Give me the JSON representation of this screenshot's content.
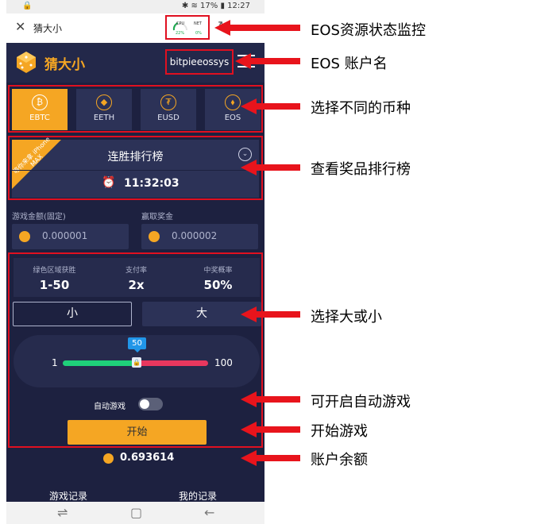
{
  "status_bar": {
    "battery": "17%",
    "time": "12:27"
  },
  "browser": {
    "title": "猜大小"
  },
  "resource_monitor": {
    "cpu_label": "CPU",
    "cpu_value": "22%",
    "net_label": "NET",
    "net_value": "0%"
  },
  "app": {
    "name": "猜大小",
    "account": "bitpieeossys"
  },
  "coins": [
    {
      "label": "EBTC",
      "icon": "bitcoin-icon",
      "active": true
    },
    {
      "label": "EETH",
      "icon": "ethereum-icon",
      "active": false
    },
    {
      "label": "EUSD",
      "icon": "tether-icon",
      "active": false
    },
    {
      "label": "EOS",
      "icon": "eos-icon",
      "active": false
    }
  ],
  "ranking": {
    "ribbon": "等你来拿 iPhone MAX",
    "title": "连胜排行榜",
    "countdown": "11:32:03"
  },
  "fields": {
    "bet_label": "游戏金额(固定)",
    "bet_value": "0.000001",
    "win_label": "赢取奖金",
    "win_value": "0.000002"
  },
  "stats": [
    {
      "label": "绿色区域获胜",
      "value": "1-50"
    },
    {
      "label": "支付率",
      "value": "2x"
    },
    {
      "label": "中奖概率",
      "value": "50%"
    }
  ],
  "choices": {
    "small": "小",
    "big": "大"
  },
  "slider": {
    "min": "1",
    "max": "100",
    "value": "50"
  },
  "auto_play": {
    "label": "自动游戏",
    "enabled": false
  },
  "start_button": "开始",
  "balance": "0.693614",
  "bottom_tabs": {
    "game_records": "游戏记录",
    "my_records": "我的记录"
  },
  "annotations": {
    "monitor": "EOS资源状态监控",
    "account": "EOS 账户名",
    "coins": "选择不同的币种",
    "ranking": "查看奖品排行榜",
    "bigsmall": "选择大或小",
    "auto": "可开启自动游戏",
    "start": "开始游戏",
    "balance": "账户余额"
  },
  "colors": {
    "accent": "#f5a623",
    "background": "#1d2140",
    "annotation_red": "#e01020"
  }
}
